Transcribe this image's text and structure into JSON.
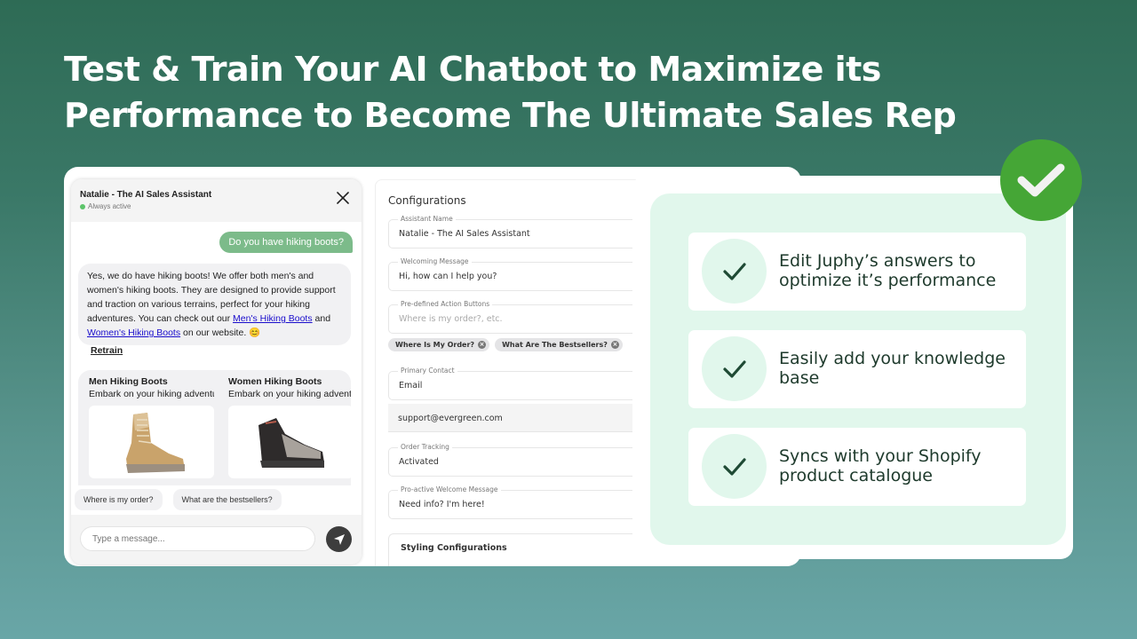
{
  "headline": {
    "line1": "Test & Train Your AI Chatbot to Maximize its",
    "line2": "Performance to Become The Ultimate Sales Rep"
  },
  "chat": {
    "title": "Natalie - The AI Sales Assistant",
    "status": "Always active",
    "user_message": "Do you have hiking boots?",
    "bot_message": {
      "text_before": "Yes, we do have hiking boots! We offer both men's and women's hiking boots. They are designed to provide support and traction on various terrains, perfect for your hiking adventures. You can check out our ",
      "link1": "Men's Hiking Boots",
      "text_middle": " and ",
      "link2": "Women's Hiking Boots",
      "text_after": " on our website. 😊"
    },
    "retrain_label": "Retrain",
    "products": [
      {
        "title": "Men Hiking Boots",
        "description": "Embark on your hiking adventures"
      },
      {
        "title": "Women Hiking Boots",
        "description": "Embark on your hiking adventures"
      }
    ],
    "quick_replies": [
      "Where is my order?",
      "What are the bestsellers?"
    ],
    "input_placeholder": "Type a message...",
    "colors": {
      "user_bubble": "#7cbb8a",
      "status_dot": "#5cc46a",
      "send_button": "#3d3d3d"
    }
  },
  "config": {
    "title": "Configurations",
    "fields": [
      {
        "label": "Assistant Name",
        "value": "Natalie - The AI Sales Assistant"
      },
      {
        "label": "Welcoming Message",
        "value": "Hi, how can I help you?"
      },
      {
        "label": "Pre-defined Action Buttons",
        "placeholder": "Where is my order?, etc."
      },
      {
        "label": "Primary Contact",
        "value": "Email"
      },
      {
        "label": "Order Tracking",
        "value": "Activated"
      },
      {
        "label": "Pro-active Welcome Message",
        "value": "Need info? I'm here!"
      }
    ],
    "chips": [
      "Where Is My Order?",
      "What Are The Bestsellers?"
    ],
    "email_value": "support@evergreen.com",
    "styling_title": "Styling Configurations"
  },
  "features": [
    {
      "text": "Edit Juphy’s answers to optimize it’s performance"
    },
    {
      "text": "Easily add your knowledge base"
    },
    {
      "text": "Syncs with your Shopify product catalogue"
    }
  ],
  "colors": {
    "accent_green": "#45a636",
    "feature_panel": "#e1f7ec",
    "check_dark": "#1e4a34"
  }
}
